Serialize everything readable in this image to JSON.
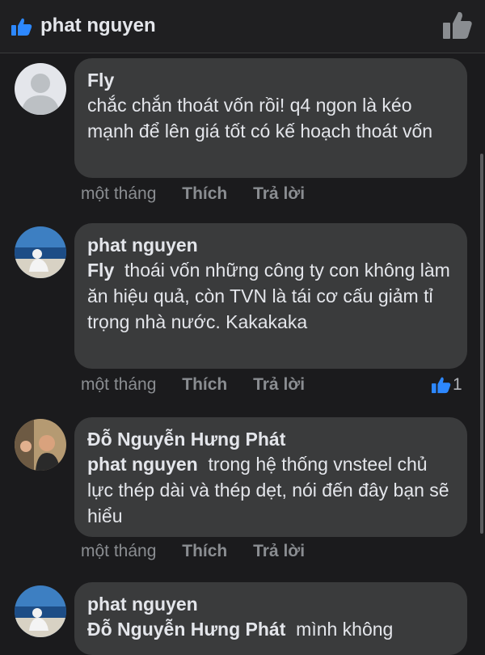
{
  "header": {
    "title": "phat nguyen"
  },
  "comments": [
    {
      "author": "Fly",
      "text": "chắc chắn thoát vốn rồi! q4 ngon là kéo mạnh để lên giá tốt có kế hoạch thoát vốn",
      "time": "một tháng",
      "like_label": "Thích",
      "reply_label": "Trả lời"
    },
    {
      "author": "phat nguyen",
      "mention": "Fly",
      "text": "thoái vốn những công ty con không làm ăn hiệu quả, còn TVN là tái cơ cấu giảm tỉ trọng nhà nước. Kakakaka",
      "time": "một tháng",
      "like_label": "Thích",
      "reply_label": "Trả lời",
      "reaction_count": "1"
    },
    {
      "author": "Đỗ Nguyễn Hưng Phát",
      "mention": "phat nguyen",
      "text": "trong hệ thống vnsteel chủ lực thép dài và thép dẹt, nói đến đây bạn sẽ hiểu",
      "time": "một tháng",
      "like_label": "Thích",
      "reply_label": "Trả lời"
    },
    {
      "author": "phat nguyen",
      "mention": "Đỗ Nguyễn Hưng Phát",
      "text": "mình không"
    }
  ]
}
